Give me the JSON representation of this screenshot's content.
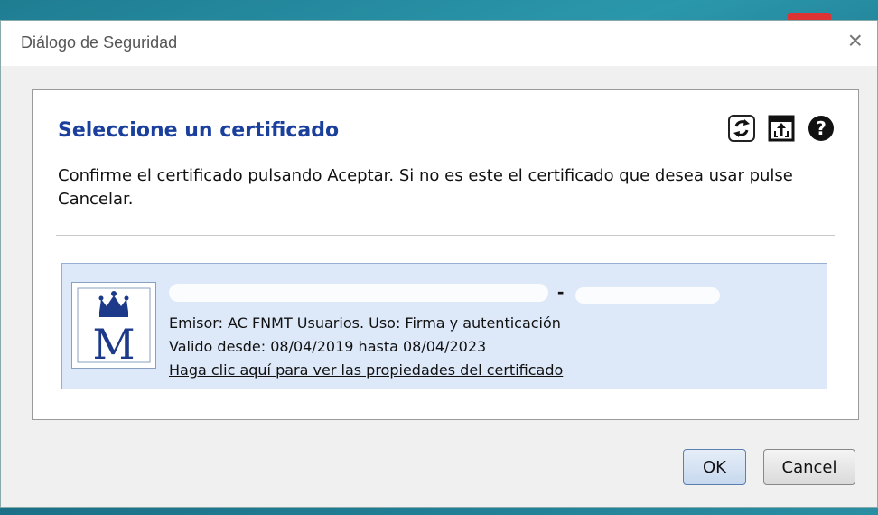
{
  "window": {
    "title": "Diálogo de Seguridad"
  },
  "dialog": {
    "heading": "Seleccione un certificado",
    "description": "Confirme el certificado pulsando Aceptar. Si no es este el certificado que desea usar pulse Cancelar.",
    "toolbar": {
      "icons": [
        "refresh-icon",
        "open-certificate-icon",
        "help-icon"
      ],
      "help_glyph": "?"
    }
  },
  "certificate": {
    "issuer_use": "Emisor: AC FNMT Usuarios. Uso: Firma y autenticación",
    "validity": "Valido desde: 08/04/2019 hasta 08/04/2023",
    "properties_link": "Haga clic aquí para ver las propiedades del certificado",
    "dash": "-",
    "logo_letter": "M"
  },
  "buttons": {
    "ok": "OK",
    "cancel": "Cancel"
  },
  "colors": {
    "heading": "#1a3f9c",
    "cert_bg": "#dde8f8",
    "ok_border": "#5b7fb0"
  }
}
